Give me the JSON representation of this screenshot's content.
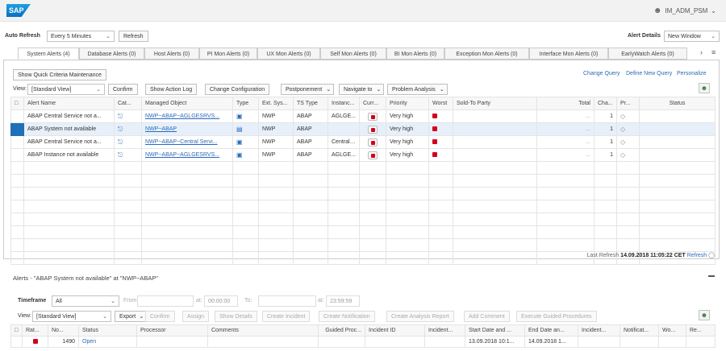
{
  "shell": {
    "logo": "SAP",
    "user": "IM_ADM_PSM"
  },
  "auto_refresh": {
    "label": "Auto Refresh",
    "value": "Every 5 Minutes",
    "refresh_button": "Refresh"
  },
  "alert_details": {
    "label": "Alert Details",
    "value": "New Window"
  },
  "tabs": [
    "System Alerts (4)",
    "Database Alerts (0)",
    "Host Alerts (0)",
    "PI Mon Alerts (0)",
    "UX Mon Alerts (0)",
    "Self Mon Alerts (0)",
    "BI Mon Alerts (0)",
    "Exception Mon Alerts (0)",
    "Interface Mon Alerts (0)",
    "EarlyWatch Alerts (0)"
  ],
  "panel": {
    "quick_criteria_button": "Show Quick Criteria Maintenance",
    "links": [
      "Change Query",
      "Define New Query",
      "Personalize"
    ],
    "view_label": "View:",
    "view_value": "[Standard View]",
    "toolbar": [
      "Confirm",
      "Show Action Log",
      "Change Configuration",
      "Postponement",
      "Navigate to",
      "Problem Analysis"
    ]
  },
  "grid": {
    "columns": [
      "Alert Name",
      "Cat...",
      "Managed Object",
      "Type",
      "Ext. Sys...",
      "TS Type",
      "Instanc...",
      "Curr...",
      "Priority",
      "Worst",
      "Sold-To Party",
      "Total",
      "Cha...",
      "Pr...",
      "Status"
    ],
    "rows": [
      {
        "name": "ABAP Central Service not a...",
        "object": "NWP~ABAP~AGLGESRVS...",
        "ext": "NWP",
        "ts": "ABAP",
        "inst": "AGLGE...",
        "prio": "Very high",
        "total": "...",
        "cha": "1"
      },
      {
        "name": "ABAP System not available",
        "object": "NWP~ABAP",
        "ext": "NWP",
        "ts": "ABAP",
        "inst": "",
        "prio": "Very high",
        "total": "...",
        "cha": "1"
      },
      {
        "name": "ABAP Central Service not a...",
        "object": "NWP~ABAP~Central Servi...",
        "ext": "NWP",
        "ts": "ABAP",
        "inst": "Central ...",
        "prio": "Very high",
        "total": "...",
        "cha": "1"
      },
      {
        "name": "ABAP Instance not available",
        "object": "NWP~ABAP~AGLGESRVS...",
        "ext": "NWP",
        "ts": "ABAP",
        "inst": "AGLGE...",
        "prio": "Very high",
        "total": "...",
        "cha": "1"
      }
    ]
  },
  "last_refresh": {
    "label": "Last Refresh",
    "value": "14.09.2018 11:05:22 CET",
    "link": "Refresh"
  },
  "details": {
    "title": "Alerts - \"ABAP System not available\" at \"NWP~ABAP\"",
    "timeframe_label": "Timeframe",
    "timeframe_value": "All",
    "from_label": "From:",
    "at_label": "at:",
    "from_time": "00:00:00",
    "to_label": "To:",
    "to_time": "23:59:59",
    "view_label": "View:",
    "view_value": "[Standard View]",
    "toolbar": [
      "Export",
      "Confirm",
      "Assign",
      "Show Details",
      "Create Incident",
      "Create Notification",
      "Create Analysis Report",
      "Add Comment",
      "Execute Guided Procedures"
    ],
    "columns": [
      "Rat...",
      "No...",
      "Status",
      "Processor",
      "Comments",
      "Guided Proc...",
      "Incident ID",
      "Incident...",
      "Start Date and ...",
      "End Date an...",
      "Incident...",
      "Notificat...",
      "Wo...",
      "Re..."
    ],
    "row": {
      "no": "1490",
      "status": "Open",
      "start": "13.09.2018 10:1...",
      "end": "14.09.2018 1..."
    }
  }
}
